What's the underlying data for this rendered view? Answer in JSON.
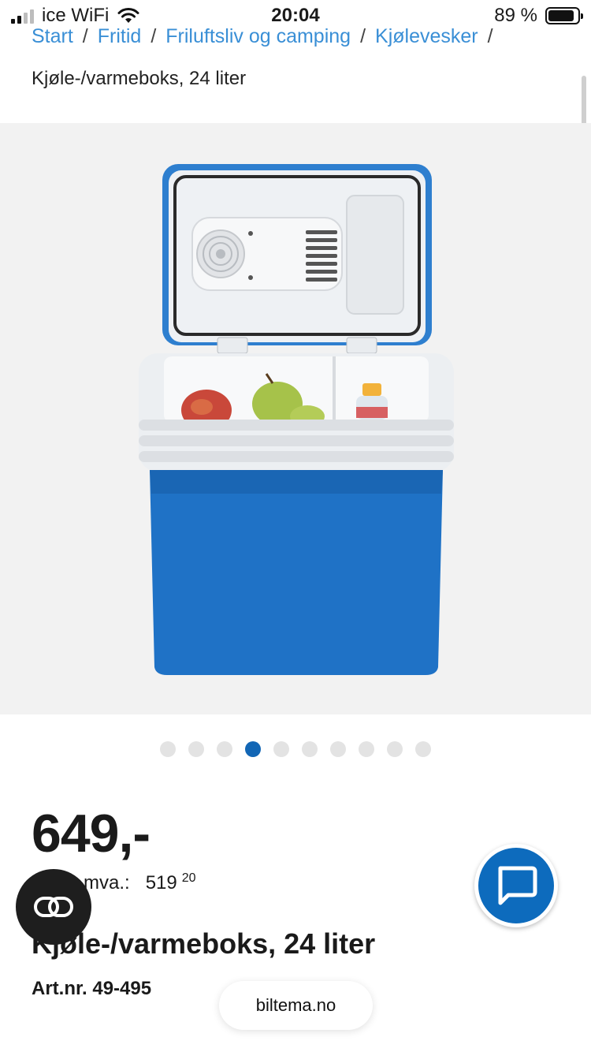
{
  "status_bar": {
    "carrier": "ice WiFi",
    "time": "20:04",
    "battery": "89 %",
    "battery_level": 0.89
  },
  "breadcrumb": {
    "items": [
      "Start",
      "Fritid",
      "Friluftsliv og camping",
      "Kjølevesker"
    ],
    "separator": "/"
  },
  "page_title": "Kjøle-/varmeboks, 24 liter",
  "gallery": {
    "image_alt_icon": "cooler-box-image",
    "dot_count": 10,
    "active_dot_index": 3
  },
  "product": {
    "price": "649,-",
    "price_ex_vat_label": "mva.:",
    "price_ex_vat_whole": "519",
    "price_ex_vat_cents": "20",
    "title": "Kjøle-/varmeboks, 24 liter",
    "article_number": "Art.nr. 49-495"
  },
  "browser": {
    "url": "biltema.no"
  },
  "colors": {
    "link": "#3a8fd6",
    "accent": "#0d6bbd",
    "cooler_blue": "#1f72c6"
  }
}
